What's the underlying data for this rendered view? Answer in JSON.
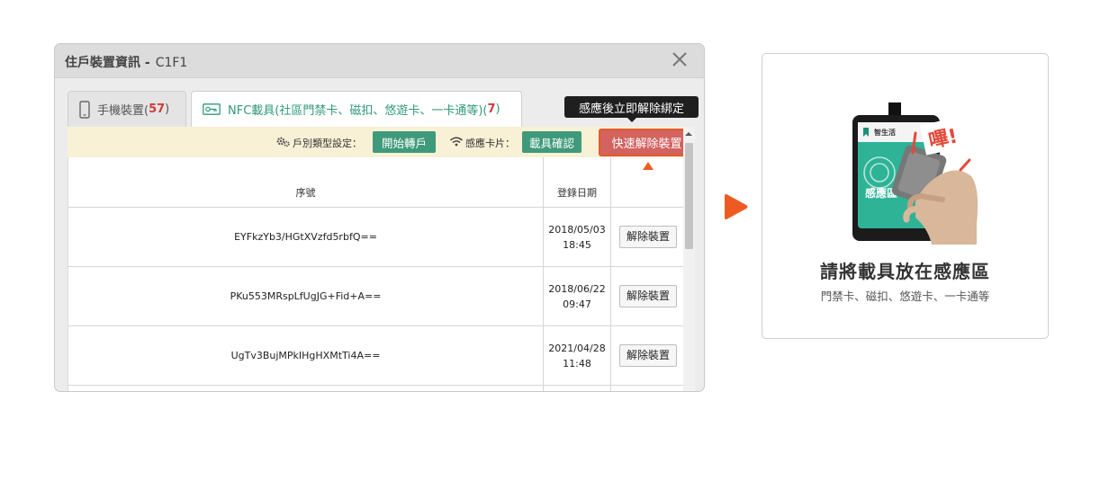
{
  "dialog": {
    "title": "住戶裝置資訊 -",
    "unit": "C1F1",
    "close_icon": "close-icon"
  },
  "tabs": [
    {
      "label": "手機裝置(",
      "count": "57",
      "suffix": ")",
      "icon": "phone-icon"
    },
    {
      "label": "NFC載具(社區門禁卡、磁扣、悠遊卡、一卡通等)(",
      "count": "7",
      "suffix": ")",
      "icon": "card-key-icon"
    }
  ],
  "toolbar": {
    "household_type_label": "戶別類型設定：",
    "transfer_button": "開始轉戶",
    "sensor_card_label": "感應卡片：",
    "confirm_button": "載具確認",
    "quick_remove_button": "快速解除裝置"
  },
  "tooltip": {
    "text": "感應後立即解除綁定"
  },
  "table": {
    "headers": {
      "serial": "序號",
      "date": "登錄日期"
    },
    "rows": [
      {
        "serial": "EYFkzYb3/HGtXVzfd5rbfQ==",
        "date": "2018/05/03",
        "time": "18:45",
        "action": "解除裝置"
      },
      {
        "serial": "PKu553MRspLfUgJG+Fid+A==",
        "date": "2018/06/22",
        "time": "09:47",
        "action": "解除裝置"
      },
      {
        "serial": "UgTv3BujMPkIHgHXMtTi4A==",
        "date": "2021/04/28",
        "time": "11:48",
        "action": "解除裝置"
      }
    ]
  },
  "card": {
    "device_brand": "智生活",
    "device_zone_label": "感應區",
    "beep_text": "嗶!",
    "title": "請將載具放在感應區",
    "subtitle": "門禁卡、磁扣、悠遊卡、一卡通等"
  },
  "colors": {
    "accent_green": "#3e9a7a",
    "quick_red": "#d2635f",
    "highlight_orange": "#ee5b22",
    "count_red": "#d23b3b"
  }
}
